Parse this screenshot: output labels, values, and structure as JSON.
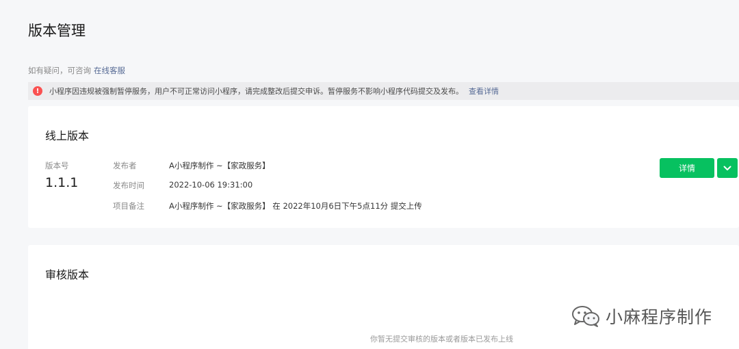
{
  "header": {
    "title": "版本管理",
    "help_prefix": "如有疑问，可咨询",
    "help_link": "在线客服"
  },
  "alert": {
    "icon": "alert-icon",
    "text": "小程序因违规被强制暂停服务，用户不可正常访问小程序，请完成整改后提交申诉。暂停服务不影响小程序代码提交及发布。",
    "link": "查看详情",
    "color": "#fa5151"
  },
  "online": {
    "title": "线上版本",
    "version_label": "版本号",
    "version": "1.1.1",
    "fields": [
      {
        "key": "发布者",
        "value": "A小程序制作 ~【家政服务】"
      },
      {
        "key": "发布时间",
        "value": "2022-10-06 19:31:00"
      },
      {
        "key": "项目备注",
        "value": "A小程序制作 ~【家政服务】 在 2022年10月6日下午5点11分 提交上传"
      }
    ],
    "detail_button": "详情",
    "accent": "#07c160"
  },
  "review": {
    "title": "审核版本",
    "empty_text": "你暂无提交审核的版本或者版本已发布上线"
  },
  "watermark": {
    "text": "小麻程序制作",
    "icon": "wechat-icon"
  }
}
